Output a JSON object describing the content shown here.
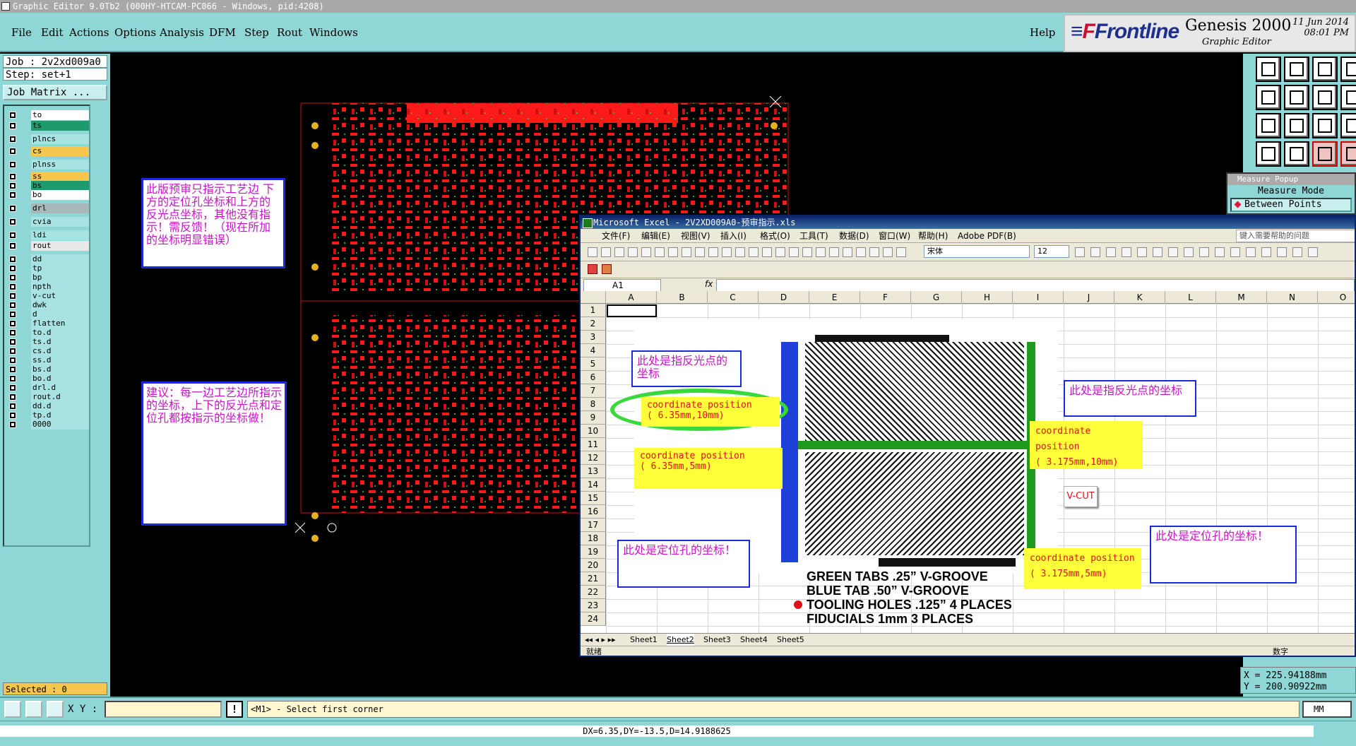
{
  "window": {
    "title": "Graphic Editor 9.0Tb2 (000HY-HTCAM-PC066 - Windows, pid:4208)"
  },
  "menu": {
    "items": [
      "File",
      "Edit",
      "Actions",
      "Options",
      "Analysis",
      "DFM",
      "Step",
      "Rout",
      "Windows"
    ],
    "help": "Help"
  },
  "brand": {
    "logo_main": "Frontline",
    "product": "Genesis 2000",
    "subtitle": "Graphic Editor",
    "date": "11 Jun 2014",
    "time": "08:01 PM"
  },
  "left": {
    "job": "Job : 2v2xd009a0",
    "step": "Step: set+1",
    "job_matrix": "Job Matrix ...",
    "selected": "Selected : 0"
  },
  "layers": [
    {
      "name": "to",
      "color": "#ffffff"
    },
    {
      "name": "ts",
      "color": "#1e9a6e"
    },
    {
      "name": "plncs",
      "color": "#a8e2e2"
    },
    {
      "name": "cs",
      "color": "#f6c74c"
    },
    {
      "name": "plnss",
      "color": "#a8e2e2"
    },
    {
      "name": "ss",
      "color": "#f6c74c"
    },
    {
      "name": "bs",
      "color": "#1e9a6e"
    },
    {
      "name": "bo",
      "color": "#ffffff"
    },
    {
      "name": "drl",
      "color": "#a8b8b8"
    },
    {
      "name": "cvia",
      "color": "#a8e2e2"
    },
    {
      "name": "ldi",
      "color": "#a8e2e2"
    },
    {
      "name": "rout",
      "color": "#e8e8e8"
    },
    {
      "name": "dd",
      "color": "#a8e2e2"
    },
    {
      "name": "tp",
      "color": "#a8e2e2"
    },
    {
      "name": "bp",
      "color": "#a8e2e2"
    },
    {
      "name": "npth",
      "color": "#a8e2e2"
    },
    {
      "name": "v-cut",
      "color": "#a8e2e2"
    },
    {
      "name": "dwk",
      "color": "#a8e2e2"
    },
    {
      "name": "d",
      "color": "#a8e2e2"
    },
    {
      "name": "flatten",
      "color": "#a8e2e2"
    },
    {
      "name": "to.d",
      "color": "#a8e2e2"
    },
    {
      "name": "ts.d",
      "color": "#a8e2e2"
    },
    {
      "name": "cs.d",
      "color": "#a8e2e2"
    },
    {
      "name": "ss.d",
      "color": "#a8e2e2"
    },
    {
      "name": "bs.d",
      "color": "#a8e2e2"
    },
    {
      "name": "bo.d",
      "color": "#a8e2e2"
    },
    {
      "name": "drl.d",
      "color": "#a8e2e2"
    },
    {
      "name": "rout.d",
      "color": "#a8e2e2"
    },
    {
      "name": "dd.d",
      "color": "#a8e2e2"
    },
    {
      "name": "tp.d",
      "color": "#a8e2e2"
    },
    {
      "name": "0000",
      "color": "#a8e2e2"
    }
  ],
  "notes": {
    "note1": "此版预审只指示工艺边 下方的定位孔坐标和上方的反光点坐标，其他没有指示！需反馈！（现在所加的坐标明显错误）",
    "note2": "建议：每一边工艺边所指示的坐标，上下的反光点和定位孔都按指示的坐标做！"
  },
  "measure": {
    "title": "Measure Popup",
    "mode": "Measure Mode",
    "between": "Between Points"
  },
  "readout": {
    "x": "X = 225.94188mm",
    "y": "Y = 200.90922mm"
  },
  "bottom": {
    "xy_label": "X Y :",
    "xy_value": "",
    "prompt": "<M1> - Select first corner",
    "unit": "MM"
  },
  "status": {
    "dx": "DX=6.35,DY=-13.5,D=14.9188625"
  },
  "excel": {
    "title": "Microsoft Excel - 2V2XD009A0-预审指示.xls",
    "menus": [
      "文件(F)",
      "编辑(E)",
      "视图(V)",
      "插入(I)",
      "格式(O)",
      "工具(T)",
      "数据(D)",
      "窗口(W)",
      "帮助(H)",
      "Adobe PDF(B)"
    ],
    "help_box": "键入需要帮助的问题",
    "font": "宋体",
    "size": "12",
    "namebox": "A1",
    "fx": "fx",
    "columns": [
      "A",
      "B",
      "C",
      "D",
      "E",
      "F",
      "G",
      "H",
      "I",
      "J",
      "K",
      "L",
      "M",
      "N",
      "O"
    ],
    "rows": [
      "1",
      "2",
      "3",
      "4",
      "5",
      "6",
      "7",
      "8",
      "9",
      "10",
      "11",
      "12",
      "13",
      "14",
      "15",
      "16",
      "17",
      "18",
      "19",
      "20",
      "21",
      "22",
      "23",
      "24"
    ],
    "sheets": [
      "Sheet1",
      "Sheet2",
      "Sheet3",
      "Sheet4",
      "Sheet5"
    ],
    "status_left": "就绪",
    "status_right": "数字",
    "callouts": {
      "top_left": "此处是指反光点的坐标",
      "top_right": "此处是指反光点的坐标",
      "bottom_left": "此处是定位孔的坐标！",
      "bottom_right": "此处是定位孔的坐标！"
    },
    "coords": {
      "c1_line1": "coordinate position",
      "c1_line2": "( 6.35mm,10mm)",
      "c2_line1": "coordinate position",
      "c2_line2": "( 6.35mm,5mm)",
      "c3_line1": "coordinate position",
      "c3_line2": "( 3.175mm,10mm)",
      "c4_line1": "coordinate position",
      "c4_line2": "( 3.175mm,5mm)"
    },
    "vcut": "V-CUT",
    "legend": [
      "GREEN TABS .25”  V-GROOVE",
      "BLUE TAB .50”  V-GROOVE",
      "TOOLING HOLES .125” 4 PLACES",
      "FIDUCIALS 1mm 3 PLACES"
    ]
  }
}
